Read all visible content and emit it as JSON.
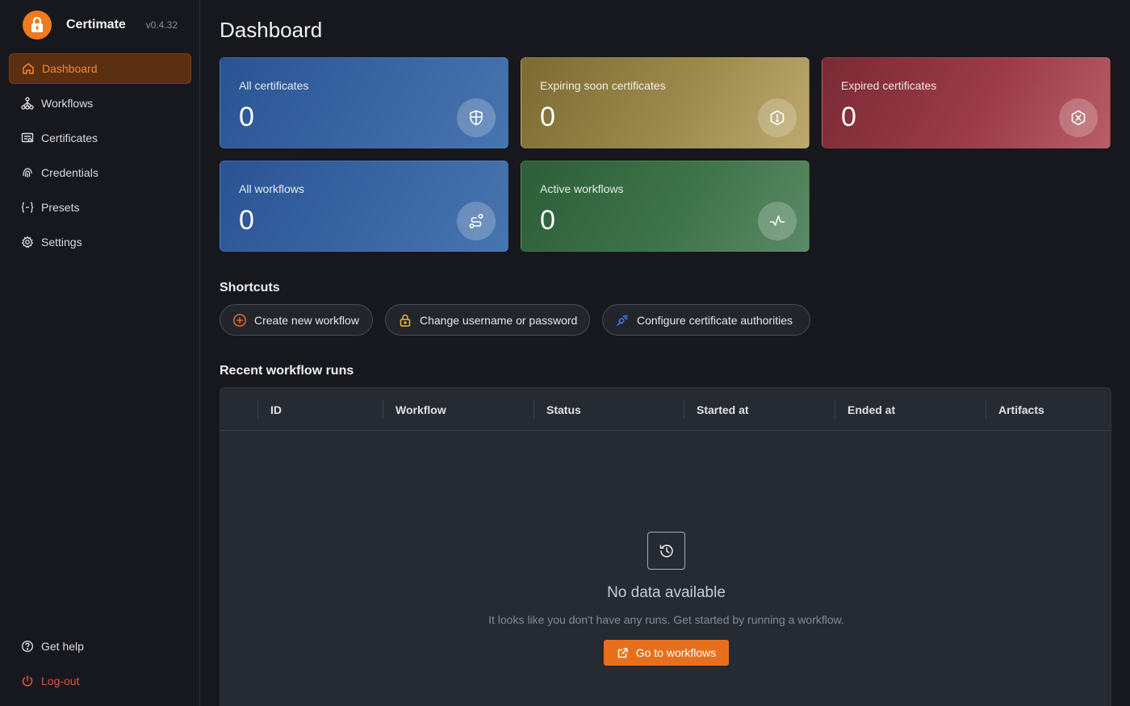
{
  "brand": {
    "name": "Certimate",
    "version": "v0.4.32"
  },
  "sidebar": {
    "items": [
      {
        "label": "Dashboard",
        "icon": "home-icon",
        "active": true
      },
      {
        "label": "Workflows",
        "icon": "workflow-icon",
        "active": false
      },
      {
        "label": "Certificates",
        "icon": "certificate-icon",
        "active": false
      },
      {
        "label": "Credentials",
        "icon": "fingerprint-icon",
        "active": false
      },
      {
        "label": "Presets",
        "icon": "braces-icon",
        "active": false
      },
      {
        "label": "Settings",
        "icon": "gear-icon",
        "active": false
      }
    ],
    "bottom": [
      {
        "label": "Get help",
        "icon": "help-circle-icon"
      },
      {
        "label": "Log-out",
        "icon": "power-icon"
      }
    ]
  },
  "page": {
    "title": "Dashboard"
  },
  "stats": [
    {
      "label": "All certificates",
      "value": "0",
      "icon": "shield-icon",
      "color": "#3a66a4"
    },
    {
      "label": "Expiring soon certificates",
      "value": "0",
      "icon": "hexagon-alert-icon",
      "color": "#9c8a4c"
    },
    {
      "label": "Expired certificates",
      "value": "0",
      "icon": "hexagon-x-icon",
      "color": "#9b3b47"
    },
    {
      "label": "All workflows",
      "value": "0",
      "icon": "route-icon",
      "color": "#3a66a4"
    },
    {
      "label": "Active workflows",
      "value": "0",
      "icon": "activity-icon",
      "color": "#3f7349"
    }
  ],
  "shortcuts": {
    "title": "Shortcuts",
    "items": [
      {
        "label": "Create new workflow",
        "icon": "plus-circle-icon"
      },
      {
        "label": "Change username or password",
        "icon": "lock-icon"
      },
      {
        "label": "Configure certificate authorities",
        "icon": "plug-icon"
      }
    ]
  },
  "recent_runs": {
    "title": "Recent workflow runs",
    "columns": [
      "ID",
      "Workflow",
      "Status",
      "Started at",
      "Ended at",
      "Artifacts"
    ],
    "empty": {
      "icon": "history-icon",
      "title": "No data available",
      "description": "It looks like you don't have any runs. Get started by running a workflow.",
      "button_label": "Go to workflows",
      "button_icon": "external-link-icon"
    }
  },
  "colors": {
    "accent": "#e8701c",
    "background": "#17181d",
    "danger": "#e0533d"
  }
}
